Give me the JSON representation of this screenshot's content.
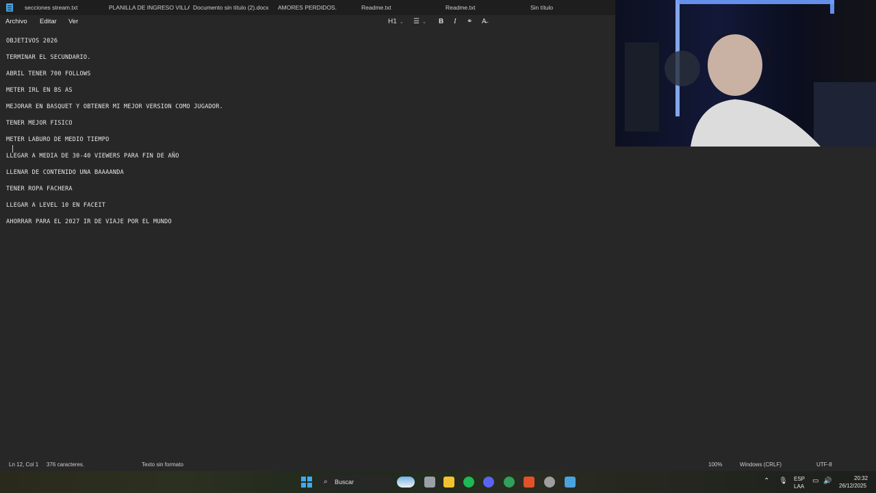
{
  "tabs": [
    {
      "label": "secciones stream.txt"
    },
    {
      "label": "PLANILLA DE INGRESO VILLA SE"
    },
    {
      "label": "Documento sin título (2).docx"
    },
    {
      "label": "AMORES PERDIDOS."
    },
    {
      "label": "Readme.txt"
    },
    {
      "label": "Readme.txt"
    },
    {
      "label": "Sin título"
    }
  ],
  "menu": {
    "archivo": "Archivo",
    "editar": "Editar",
    "ver": "Ver"
  },
  "toolbar": {
    "heading": "H1",
    "list": "☰",
    "bold": "B",
    "italic": "I",
    "link": "⚭",
    "clear": "A̶"
  },
  "editor": {
    "lines": [
      "OBJETIVOS 2026",
      "TERMINAR EL SECUNDARIO.",
      "ABRIL TENER 700 FOLLOWS",
      "METER IRL EN BS AS",
      "MEJORAR EN BASQUET Y OBTENER MI MEJOR VERSION COMO JUGADOR.",
      "TENER MEJOR FISICO",
      "METER LABURO DE MEDIO TIEMPO",
      "LLEGAR A MEDIA DE 30-40 VIEWERS PARA FIN DE AÑO",
      "LLENAR DE CONTENIDO UNA BAAAANDA",
      "TENER ROPA FACHERA",
      "LLEGAR A LEVEL 10 EN FACEIT",
      "AHORRAR PARA EL 2027 IR DE VIAJE POR EL MUNDO"
    ]
  },
  "status": {
    "position": "Ln 12, Col 1",
    "chars": "376 caracteres.",
    "format": "Texto sin formato",
    "zoom": "100%",
    "line_ending": "Windows (CRLF)",
    "encoding": "UTF-8"
  },
  "taskbar": {
    "search_placeholder": "Buscar",
    "lang_top": "ESP",
    "lang_bottom": "LAA",
    "time": "20:32",
    "date": "26/12/2025"
  }
}
